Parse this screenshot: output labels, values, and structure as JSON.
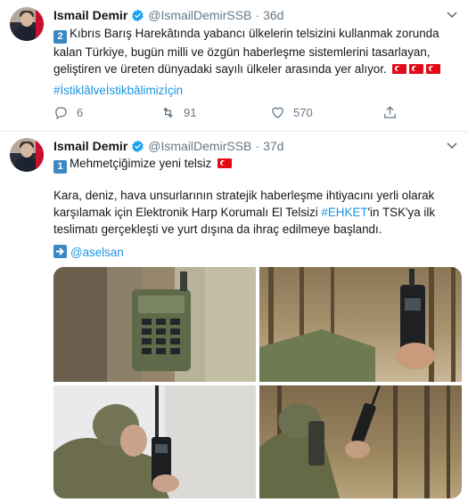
{
  "tweets": [
    {
      "name": "Ismail Demir",
      "handle": "@IsmailDemirSSB",
      "separator": "·",
      "time": "36d",
      "number_badge": "2",
      "text": "Kıbrıs Barış Harekâtında yabancı ülkelerin telsizini kullanmak zorunda kalan Türkiye, bugün milli ve özgün haberleşme sistemlerini tasarlayan, geliştiren ve üreten dünyadaki sayılı ülkeler arasında yer alıyor.",
      "hashtag": "#İstiklâlveİstikbâlimizİçin",
      "replies": "6",
      "retweets": "91",
      "likes": "570"
    },
    {
      "name": "Ismail Demir",
      "handle": "@IsmailDemirSSB",
      "separator": "·",
      "time": "37d",
      "number_badge": "1",
      "title": "Mehmetçiğimize yeni telsiz",
      "text_before": "Kara, deniz, hava unsurlarının stratejik haberleşme ihtiyacını yerli olarak karşılamak için Elektronik Harp Korumalı El Telsizi ",
      "hashtag": "#EHKET",
      "text_after": "'in TSK'ya ilk teslimatı gerçekleşti ve yurt dışına da ihraç edilmeye başlandı.",
      "mention": "@aselsan"
    }
  ],
  "icons": [
    "verified-badge-icon",
    "caret-down-icon",
    "reply-icon",
    "retweet-icon",
    "like-icon",
    "share-icon",
    "right-arrow-icon",
    "turkish-flag-icon"
  ],
  "colors": {
    "link": "#1b95e0",
    "muted": "#657786",
    "badge": "#3b88c3",
    "flag_red": "#e30a17"
  }
}
